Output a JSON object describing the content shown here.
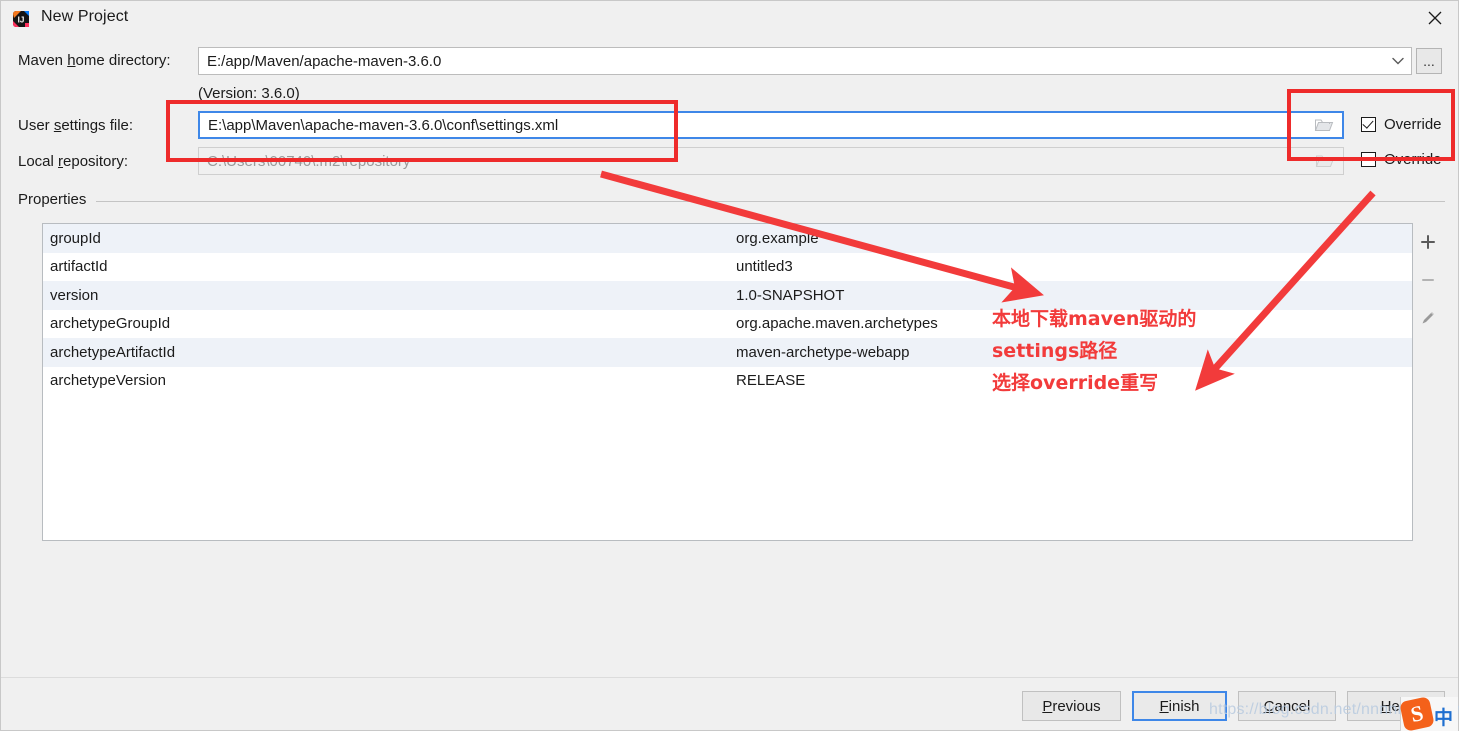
{
  "window": {
    "title": "New Project",
    "app_icon": "intellij-idea-icon",
    "close_icon": "close-icon"
  },
  "form": {
    "maven_home": {
      "label_pre": "Maven ",
      "label_accel": "h",
      "label_post": "ome directory:",
      "value": "E:/app/Maven/apache-maven-3.6.0",
      "dropdown_icon": "chevron-down-icon",
      "browse_label": "...",
      "version_note": "(Version: 3.6.0)"
    },
    "user_settings": {
      "label_pre": "User ",
      "label_accel": "s",
      "label_post": "ettings file:",
      "value": "E:\\app\\Maven\\apache-maven-3.6.0\\conf\\settings.xml",
      "folder_icon": "folder-icon",
      "override_label": "Override",
      "override_checked": true
    },
    "local_repository": {
      "label_pre": "Local ",
      "label_accel": "r",
      "label_post": "epository:",
      "value": "C:\\Users\\00740\\.m2\\repository",
      "folder_icon": "folder-icon",
      "override_label": "Override",
      "override_checked": false
    }
  },
  "properties": {
    "group_label": "Properties",
    "rows": [
      {
        "key": "groupId",
        "value": "org.example"
      },
      {
        "key": "artifactId",
        "value": "untitled3"
      },
      {
        "key": "version",
        "value": "1.0-SNAPSHOT"
      },
      {
        "key": "archetypeGroupId",
        "value": "org.apache.maven.archetypes"
      },
      {
        "key": "archetypeArtifactId",
        "value": "maven-archetype-webapp"
      },
      {
        "key": "archetypeVersion",
        "value": "RELEASE"
      }
    ],
    "toolbar": {
      "add_icon": "plus-icon",
      "remove_icon": "minus-icon",
      "edit_icon": "pencil-icon"
    }
  },
  "buttons": {
    "previous": {
      "pre": "",
      "accel": "P",
      "post": "revious"
    },
    "finish": {
      "pre": "",
      "accel": "F",
      "post": "inish"
    },
    "cancel": {
      "pre": "",
      "accel": "C",
      "post": "ancel"
    },
    "help": {
      "pre": "",
      "accel": "H",
      "post": "elp"
    }
  },
  "annotations": {
    "line1": "本地下载maven驱动的",
    "line2": "settings路径",
    "line3": "选择override重写",
    "accent_color": "#f23b3b"
  },
  "watermark": {
    "text": "https://blog.csdn.net/nnnnnnnnnnnn"
  },
  "ime": {
    "logo_letter": "S",
    "mode": "中"
  }
}
